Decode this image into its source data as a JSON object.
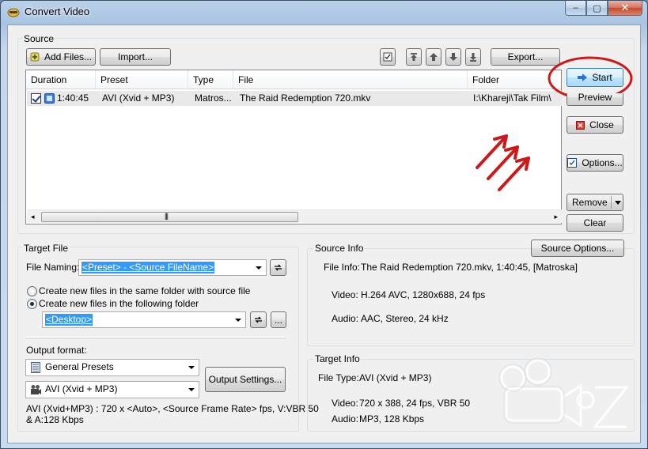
{
  "window": {
    "title": "Convert Video",
    "minimize": "–",
    "maximize": "▢",
    "close": "✕"
  },
  "source": {
    "group_title": "Source",
    "add_files": "Add Files...",
    "import": "Import...",
    "export": "Export...",
    "columns": [
      "Duration",
      "Preset",
      "Type",
      "File",
      "Folder"
    ],
    "rows": [
      {
        "duration": "1:40:45",
        "preset": "AVI (Xvid + MP3)",
        "type": "Matros...",
        "file": "The Raid Redemption 720.mkv",
        "folder": "I:\\Khareji\\Tak Film\\"
      }
    ]
  },
  "side_buttons": {
    "start": "Start",
    "preview": "Preview",
    "close": "Close",
    "options": "Options...",
    "remove": "Remove",
    "clear": "Clear"
  },
  "target_file": {
    "group_title": "Target File",
    "naming_label": "File Naming:",
    "naming_value": "<Preset> - <Source FileName>",
    "radio_same": "Create new files in the same folder with source file",
    "radio_following": "Create new files in the following folder",
    "folder_value": "<Desktop>",
    "browse": "...",
    "output_format_label": "Output format:",
    "preset_group": "General Presets",
    "preset": "AVI (Xvid + MP3)",
    "output_settings": "Output Settings...",
    "format_desc_1": "AVI (Xvid+MP3) : 720 x <Auto>, <Source Frame Rate> fps, V:VBR 50",
    "format_desc_2": "& A:128 Kbps"
  },
  "source_info": {
    "group_title": "Source Info",
    "options_button": "Source Options...",
    "file_info_label": "File Info:",
    "file_info_value": "The Raid Redemption 720.mkv, 1:40:45,  [Matroska]",
    "video_label": "Video:",
    "video_value": "H.264 AVC, 1280x688, 24 fps",
    "audio_label": "Audio:",
    "audio_value": "AAC, Stereo, 24 kHz"
  },
  "target_info": {
    "group_title": "Target Info",
    "file_type_label": "File Type:",
    "file_type_value": "AVI (Xvid + MP3)",
    "video_label": "Video:",
    "video_value": "720 x 388, 24 fps, VBR 50",
    "audio_label": "Audio:",
    "audio_value": "MP3, 128 Kbps"
  },
  "colors": {
    "annotation_red": "#cc1a1a",
    "selection_blue": "#3399ff"
  }
}
